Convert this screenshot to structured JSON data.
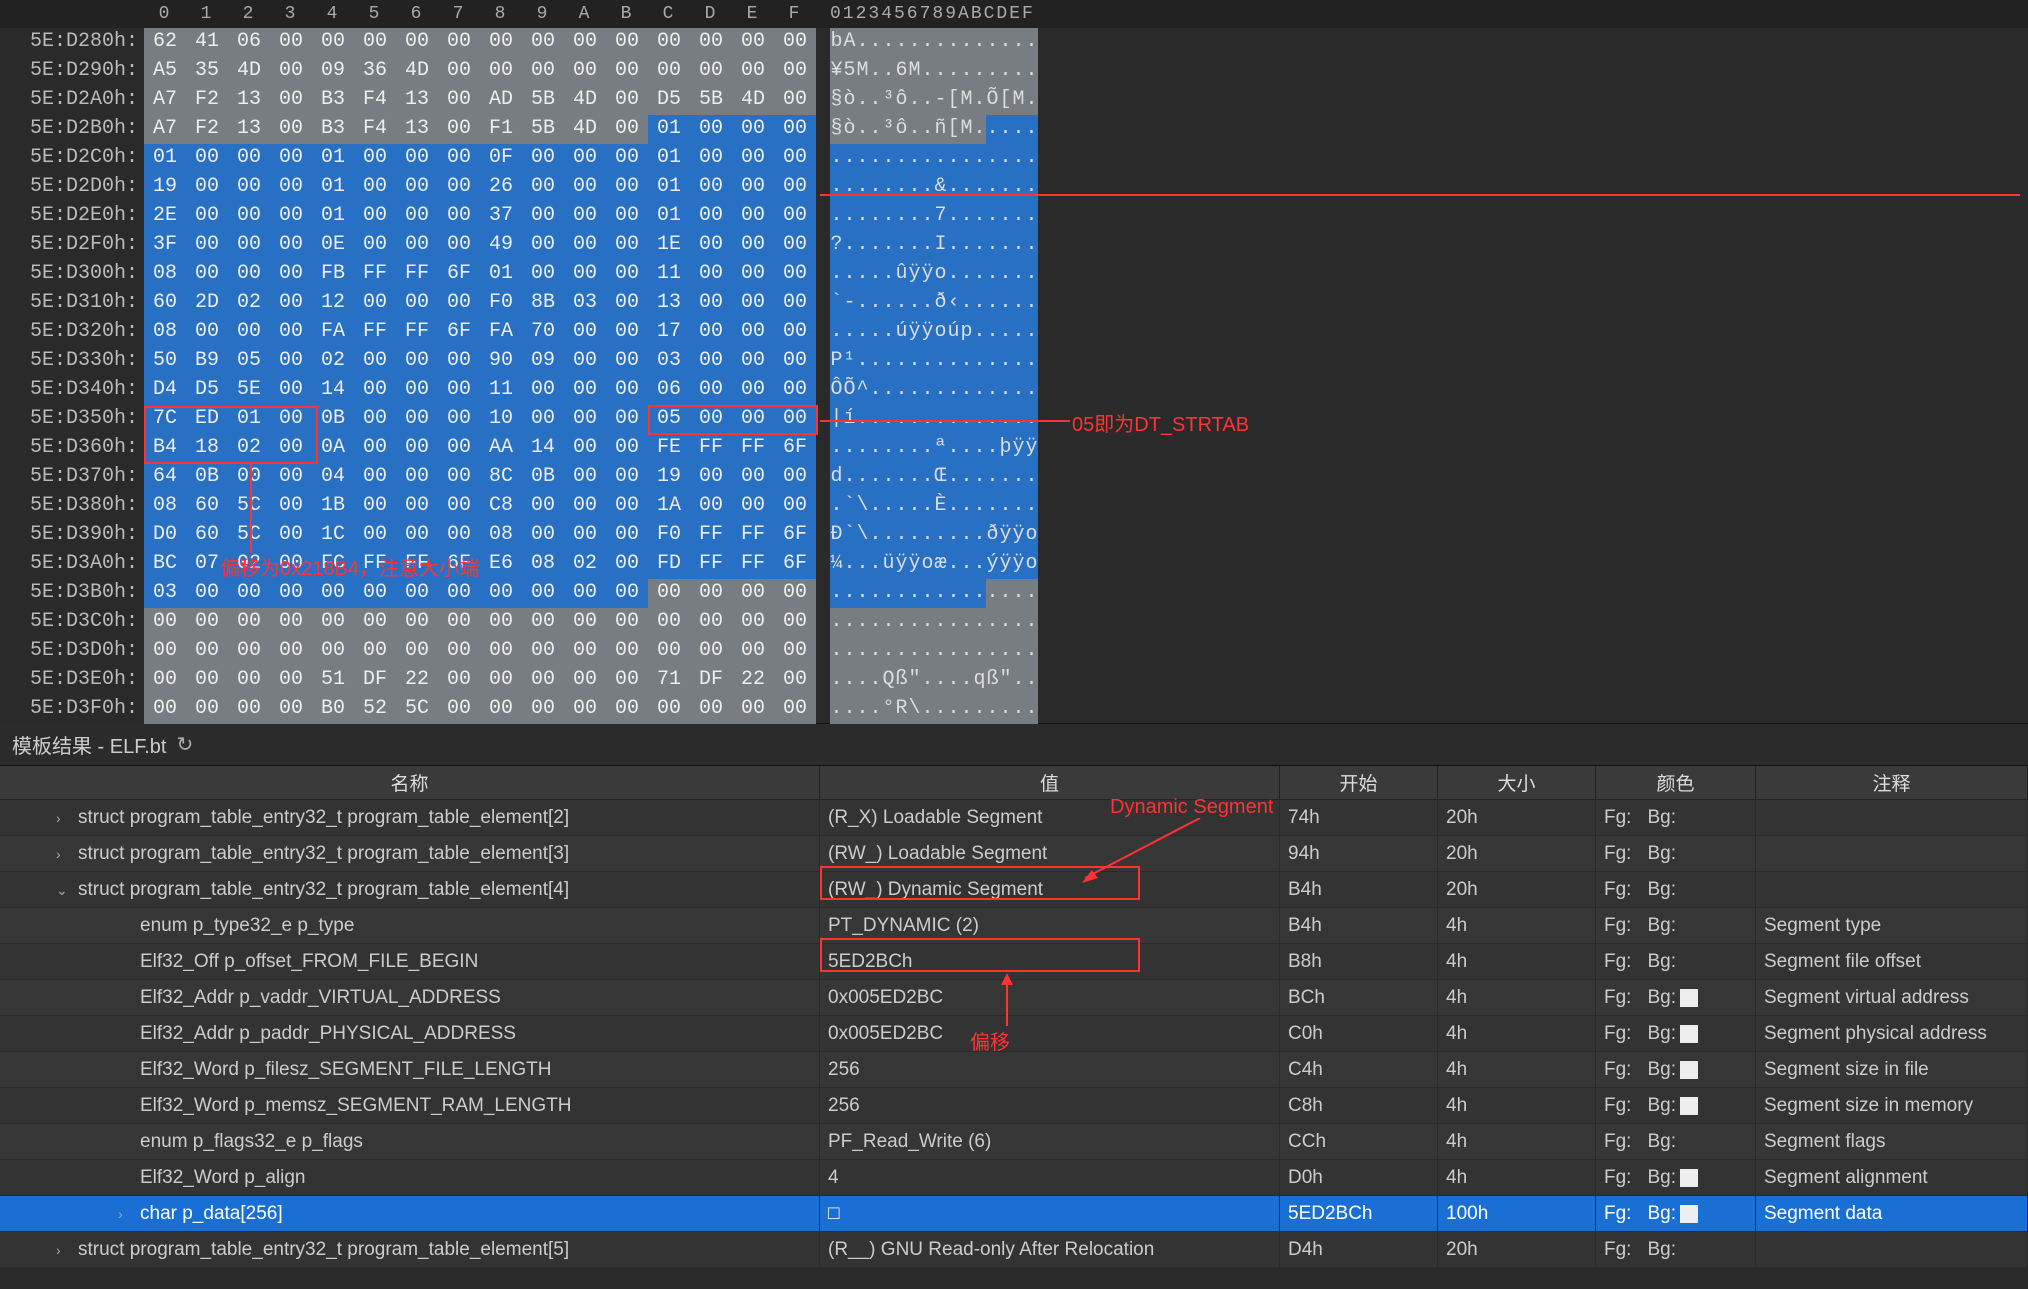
{
  "hex": {
    "ruler_cols": [
      "0",
      "1",
      "2",
      "3",
      "4",
      "5",
      "6",
      "7",
      "8",
      "9",
      "A",
      "B",
      "C",
      "D",
      "E",
      "F"
    ],
    "ruler_ascii": "0123456789ABCDEF",
    "rows": [
      {
        "addr": "5E:D280h:",
        "b": [
          "62",
          "41",
          "06",
          "00",
          "00",
          "00",
          "00",
          "00",
          "00",
          "00",
          "00",
          "00",
          "00",
          "00",
          "00",
          "00"
        ],
        "a": "bA..............",
        "selStart": -1,
        "aSel": 16
      },
      {
        "addr": "5E:D290h:",
        "b": [
          "A5",
          "35",
          "4D",
          "00",
          "09",
          "36",
          "4D",
          "00",
          "00",
          "00",
          "00",
          "00",
          "00",
          "00",
          "00",
          "00"
        ],
        "a": "¥5M..6M.........",
        "selStart": -1,
        "aSel": 16
      },
      {
        "addr": "5E:D2A0h:",
        "b": [
          "A7",
          "F2",
          "13",
          "00",
          "B3",
          "F4",
          "13",
          "00",
          "AD",
          "5B",
          "4D",
          "00",
          "D5",
          "5B",
          "4D",
          "00"
        ],
        "a": "§ò..³ô..-[M.Õ[M.",
        "selStart": -1,
        "aSel": 16
      },
      {
        "addr": "5E:D2B0h:",
        "b": [
          "A7",
          "F2",
          "13",
          "00",
          "B3",
          "F4",
          "13",
          "00",
          "F1",
          "5B",
          "4D",
          "00",
          "01",
          "00",
          "00",
          "00"
        ],
        "a": "§ò..³ô..ñ[M.....",
        "selStart": 12,
        "aSel": 12
      },
      {
        "addr": "5E:D2C0h:",
        "b": [
          "01",
          "00",
          "00",
          "00",
          "01",
          "00",
          "00",
          "00",
          "0F",
          "00",
          "00",
          "00",
          "01",
          "00",
          "00",
          "00"
        ],
        "a": "................",
        "selStart": 0,
        "aSel": 0
      },
      {
        "addr": "5E:D2D0h:",
        "b": [
          "19",
          "00",
          "00",
          "00",
          "01",
          "00",
          "00",
          "00",
          "26",
          "00",
          "00",
          "00",
          "01",
          "00",
          "00",
          "00"
        ],
        "a": "........&.......",
        "selStart": 0,
        "aSel": 0
      },
      {
        "addr": "5E:D2E0h:",
        "b": [
          "2E",
          "00",
          "00",
          "00",
          "01",
          "00",
          "00",
          "00",
          "37",
          "00",
          "00",
          "00",
          "01",
          "00",
          "00",
          "00"
        ],
        "a": "........7.......",
        "selStart": 0,
        "aSel": 0
      },
      {
        "addr": "5E:D2F0h:",
        "b": [
          "3F",
          "00",
          "00",
          "00",
          "0E",
          "00",
          "00",
          "00",
          "49",
          "00",
          "00",
          "00",
          "1E",
          "00",
          "00",
          "00"
        ],
        "a": "?.......I.......",
        "selStart": 0,
        "aSel": 0
      },
      {
        "addr": "5E:D300h:",
        "b": [
          "08",
          "00",
          "00",
          "00",
          "FB",
          "FF",
          "FF",
          "6F",
          "01",
          "00",
          "00",
          "00",
          "11",
          "00",
          "00",
          "00"
        ],
        "a": ".....ûÿÿo........",
        "selStart": 0,
        "aSel": 0
      },
      {
        "addr": "5E:D310h:",
        "b": [
          "60",
          "2D",
          "02",
          "00",
          "12",
          "00",
          "00",
          "00",
          "F0",
          "8B",
          "03",
          "00",
          "13",
          "00",
          "00",
          "00"
        ],
        "a": "`-......ð‹......",
        "selStart": 0,
        "aSel": 0
      },
      {
        "addr": "5E:D320h:",
        "b": [
          "08",
          "00",
          "00",
          "00",
          "FA",
          "FF",
          "FF",
          "6F",
          "FA",
          "70",
          "00",
          "00",
          "17",
          "00",
          "00",
          "00"
        ],
        "a": ".....úÿÿoúp......",
        "selStart": 0,
        "aSel": 0
      },
      {
        "addr": "5E:D330h:",
        "b": [
          "50",
          "B9",
          "05",
          "00",
          "02",
          "00",
          "00",
          "00",
          "90",
          "09",
          "00",
          "00",
          "03",
          "00",
          "00",
          "00"
        ],
        "a": "P¹..............",
        "selStart": 0,
        "aSel": 0
      },
      {
        "addr": "5E:D340h:",
        "b": [
          "D4",
          "D5",
          "5E",
          "00",
          "14",
          "00",
          "00",
          "00",
          "11",
          "00",
          "00",
          "00",
          "06",
          "00",
          "00",
          "00"
        ],
        "a": "ÔÕ^.............",
        "selStart": 0,
        "aSel": 0
      },
      {
        "addr": "5E:D350h:",
        "b": [
          "7C",
          "ED",
          "01",
          "00",
          "0B",
          "00",
          "00",
          "00",
          "10",
          "00",
          "00",
          "00",
          "05",
          "00",
          "00",
          "00"
        ],
        "a": "|í..............",
        "selStart": 0,
        "aSel": 0
      },
      {
        "addr": "5E:D360h:",
        "b": [
          "B4",
          "18",
          "02",
          "00",
          "0A",
          "00",
          "00",
          "00",
          "AA",
          "14",
          "00",
          "00",
          "FE",
          "FF",
          "FF",
          "6F"
        ],
        "a": "........ª....þÿÿo",
        "selStart": 0,
        "aSel": 0
      },
      {
        "addr": "5E:D370h:",
        "b": [
          "64",
          "0B",
          "00",
          "00",
          "04",
          "00",
          "00",
          "00",
          "8C",
          "0B",
          "00",
          "00",
          "19",
          "00",
          "00",
          "00"
        ],
        "a": "d.......Œ.......",
        "selStart": 0,
        "aSel": 0
      },
      {
        "addr": "5E:D380h:",
        "b": [
          "08",
          "60",
          "5C",
          "00",
          "1B",
          "00",
          "00",
          "00",
          "C8",
          "00",
          "00",
          "00",
          "1A",
          "00",
          "00",
          "00"
        ],
        "a": ".`\\.....È.......",
        "selStart": 0,
        "aSel": 0
      },
      {
        "addr": "5E:D390h:",
        "b": [
          "D0",
          "60",
          "5C",
          "00",
          "1C",
          "00",
          "00",
          "00",
          "08",
          "00",
          "00",
          "00",
          "F0",
          "FF",
          "FF",
          "6F"
        ],
        "a": "Ð`\\.........ðÿÿo",
        "selStart": 0,
        "aSel": 0
      },
      {
        "addr": "5E:D3A0h:",
        "b": [
          "BC",
          "07",
          "02",
          "00",
          "FC",
          "FF",
          "FF",
          "6F",
          "E6",
          "08",
          "02",
          "00",
          "FD",
          "FF",
          "FF",
          "6F"
        ],
        "a": "¼...üÿÿoæ...ýÿÿo",
        "selStart": 0,
        "aSel": 0
      },
      {
        "addr": "5E:D3B0h:",
        "b": [
          "03",
          "00",
          "00",
          "00",
          "00",
          "00",
          "00",
          "00",
          "00",
          "00",
          "00",
          "00",
          "00",
          "00",
          "00",
          "00"
        ],
        "a": "................",
        "selStart": 0,
        "aSel": 0,
        "selEnd": 11
      },
      {
        "addr": "5E:D3C0h:",
        "b": [
          "00",
          "00",
          "00",
          "00",
          "00",
          "00",
          "00",
          "00",
          "00",
          "00",
          "00",
          "00",
          "00",
          "00",
          "00",
          "00"
        ],
        "a": "................",
        "selStart": -1,
        "aSel": 16
      },
      {
        "addr": "5E:D3D0h:",
        "b": [
          "00",
          "00",
          "00",
          "00",
          "00",
          "00",
          "00",
          "00",
          "00",
          "00",
          "00",
          "00",
          "00",
          "00",
          "00",
          "00"
        ],
        "a": "................",
        "selStart": -1,
        "aSel": 16
      },
      {
        "addr": "5E:D3E0h:",
        "b": [
          "00",
          "00",
          "00",
          "00",
          "51",
          "DF",
          "22",
          "00",
          "00",
          "00",
          "00",
          "00",
          "71",
          "DF",
          "22",
          "00"
        ],
        "a": "....Qß\"....qß\"..",
        "selStart": -1,
        "aSel": 16
      },
      {
        "addr": "5E:D3F0h:",
        "b": [
          "00",
          "00",
          "00",
          "00",
          "B0",
          "52",
          "5C",
          "00",
          "00",
          "00",
          "00",
          "00",
          "00",
          "00",
          "00",
          "00"
        ],
        "a": "....°R\\.........",
        "selStart": -1,
        "aSel": 16
      }
    ]
  },
  "annotations": {
    "box1_label": "05即为DT_STRTAB",
    "box2_label": "偏移为0x218B4，注意大小端",
    "dynamic_label": "Dynamic Segment",
    "offset_label": "偏移"
  },
  "panel": {
    "title": "模板结果 - ELF.bt",
    "columns": {
      "name": "名称",
      "value": "值",
      "start": "开始",
      "size": "大小",
      "color": "颜色",
      "comment": "注释"
    },
    "bg": "Bg:",
    "fg": "Fg:"
  },
  "rows": [
    {
      "indent": 1,
      "exp": "›",
      "name": "struct program_table_entry32_t program_table_element[2]",
      "value": "(R_X) Loadable Segment",
      "start": "74h",
      "size": "20h",
      "swatch": false,
      "comment": ""
    },
    {
      "indent": 1,
      "exp": "›",
      "name": "struct program_table_entry32_t program_table_element[3]",
      "value": "(RW_) Loadable Segment",
      "start": "94h",
      "size": "20h",
      "swatch": false,
      "comment": ""
    },
    {
      "indent": 1,
      "exp": "⌄",
      "name": "struct program_table_entry32_t program_table_element[4]",
      "value": "(RW_) Dynamic Segment",
      "start": "B4h",
      "size": "20h",
      "swatch": false,
      "comment": "",
      "valueBox": true
    },
    {
      "indent": 2,
      "exp": "",
      "name": "enum p_type32_e p_type",
      "value": "PT_DYNAMIC (2)",
      "start": "B4h",
      "size": "4h",
      "swatch": false,
      "comment": "Segment type"
    },
    {
      "indent": 2,
      "exp": "",
      "name": "Elf32_Off p_offset_FROM_FILE_BEGIN",
      "value": "5ED2BCh",
      "start": "B8h",
      "size": "4h",
      "swatch": false,
      "comment": "Segment file offset",
      "valueBox": true
    },
    {
      "indent": 2,
      "exp": "",
      "name": "Elf32_Addr p_vaddr_VIRTUAL_ADDRESS",
      "value": "0x005ED2BC",
      "start": "BCh",
      "size": "4h",
      "swatch": true,
      "comment": "Segment virtual address"
    },
    {
      "indent": 2,
      "exp": "",
      "name": "Elf32_Addr p_paddr_PHYSICAL_ADDRESS",
      "value": "0x005ED2BC",
      "start": "C0h",
      "size": "4h",
      "swatch": true,
      "comment": "Segment physical address"
    },
    {
      "indent": 2,
      "exp": "",
      "name": "Elf32_Word p_filesz_SEGMENT_FILE_LENGTH",
      "value": "256",
      "start": "C4h",
      "size": "4h",
      "swatch": true,
      "comment": "Segment size in file"
    },
    {
      "indent": 2,
      "exp": "",
      "name": "Elf32_Word p_memsz_SEGMENT_RAM_LENGTH",
      "value": "256",
      "start": "C8h",
      "size": "4h",
      "swatch": true,
      "comment": "Segment size in memory"
    },
    {
      "indent": 2,
      "exp": "",
      "name": "enum p_flags32_e p_flags",
      "value": "PF_Read_Write (6)",
      "start": "CCh",
      "size": "4h",
      "swatch": false,
      "comment": "Segment flags"
    },
    {
      "indent": 2,
      "exp": "",
      "name": "Elf32_Word p_align",
      "value": "4",
      "start": "D0h",
      "size": "4h",
      "swatch": true,
      "comment": "Segment alignment"
    },
    {
      "indent": 2,
      "exp": "›",
      "name": "char p_data[256]",
      "value": "□",
      "start": "5ED2BCh",
      "size": "100h",
      "swatch": true,
      "comment": "Segment data",
      "selected": true
    },
    {
      "indent": 1,
      "exp": "›",
      "name": "struct program_table_entry32_t program_table_element[5]",
      "value": "(R__) GNU Read-only After Relocation",
      "start": "D4h",
      "size": "20h",
      "swatch": false,
      "comment": ""
    }
  ]
}
